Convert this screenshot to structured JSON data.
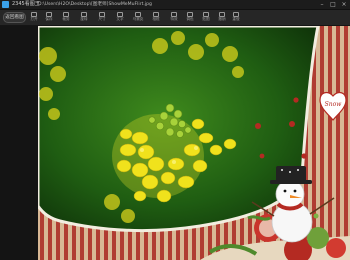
{
  "window": {
    "app_name": "2345看图王",
    "file_path": "D:\\Users\\H2O\\Desktop\\[图老师]ShowMeMuFlirt.jpg",
    "controls": [
      "–",
      "□",
      "×"
    ]
  },
  "toolbar": {
    "return_label": "返回看图",
    "tools": [
      {
        "icon": "open-icon",
        "label": "打开"
      },
      {
        "icon": "save-icon",
        "label": "保存"
      },
      {
        "icon": "crop-icon",
        "label": "裁剪"
      },
      {
        "icon": "rotate-icon",
        "label": "旋转"
      },
      {
        "icon": "size-icon",
        "label": "尺寸"
      },
      {
        "icon": "text-icon",
        "label": "文字"
      },
      {
        "icon": "mosaic-icon",
        "label": "马赛克"
      },
      {
        "icon": "frame-icon",
        "label": "相框"
      },
      {
        "icon": "effect-icon",
        "label": "特效"
      },
      {
        "icon": "adjust-icon",
        "label": "调色"
      },
      {
        "icon": "sticker-icon",
        "label": "贴图"
      },
      {
        "icon": "undo-icon",
        "label": "撤销"
      },
      {
        "icon": "redo-icon",
        "label": "重做"
      }
    ]
  },
  "photo": {
    "sticker_text": "Snow",
    "colors": {
      "flower": "#f0e21c",
      "flower_light": "#f8f06a",
      "bud": "#a8d23a",
      "background": "#1f5d12",
      "frame_stripe_red": "#b03c32",
      "frame_stripe_tan": "#d8b895"
    }
  }
}
